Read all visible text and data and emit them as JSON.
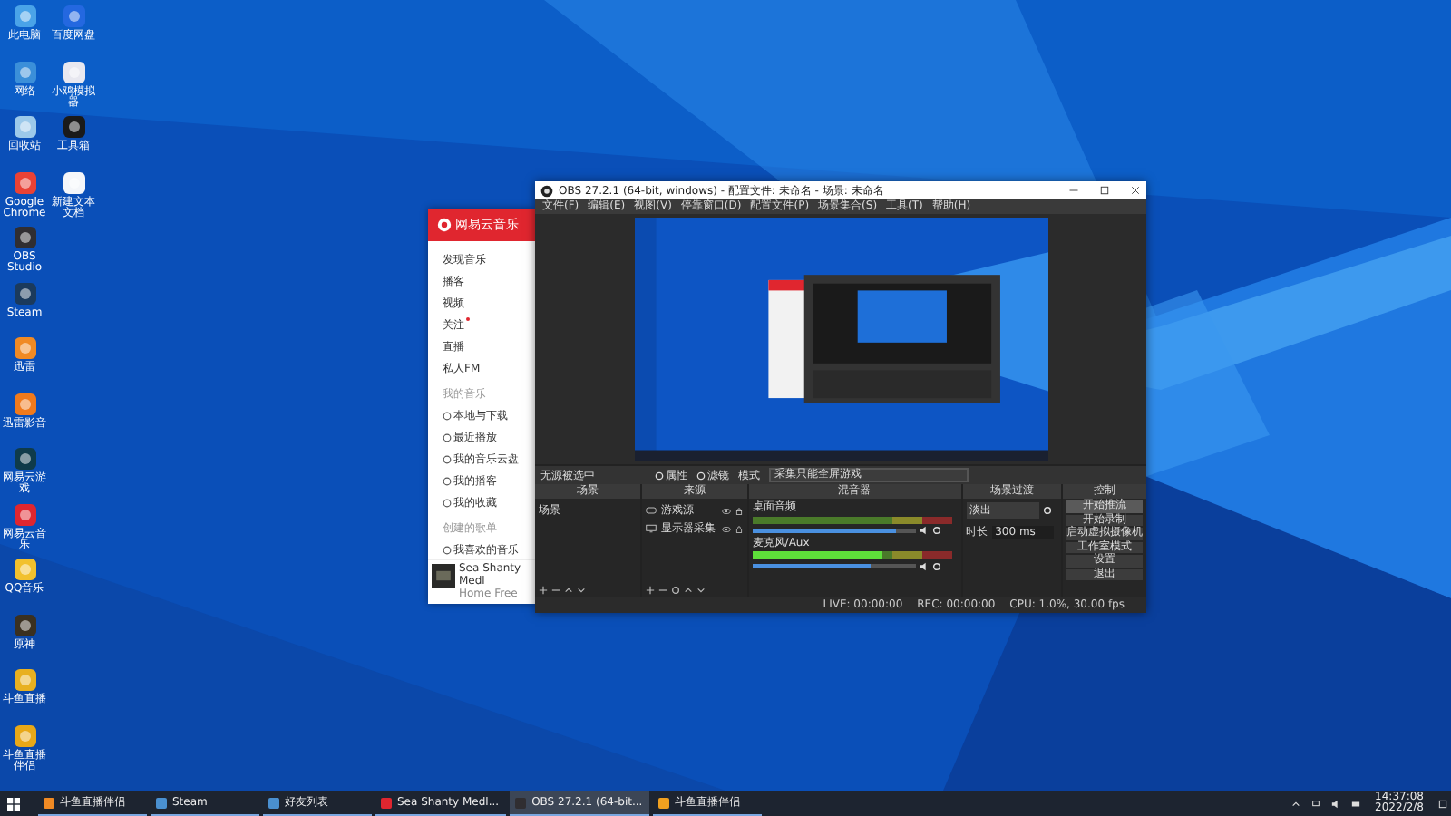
{
  "desktop_icons": {
    "column_1": [
      {
        "label": "此电脑",
        "color": "#4aa3e8"
      },
      {
        "label": "网络",
        "color": "#3b8fd9"
      },
      {
        "label": "回收站",
        "color": "#9cc9ea"
      },
      {
        "label": "Google Chrome",
        "color": "#e94235"
      },
      {
        "label": "OBS Studio",
        "color": "#302e31"
      },
      {
        "label": "Steam",
        "color": "#1b3a5c"
      },
      {
        "label": "迅雷",
        "color": "#f08a24"
      },
      {
        "label": "迅雷影音",
        "color": "#f07a1c"
      },
      {
        "label": "网易云游戏",
        "color": "#0f3b4a"
      },
      {
        "label": "网易云音乐",
        "color": "#e0262f"
      },
      {
        "label": "QQ音乐",
        "color": "#f2c12e"
      },
      {
        "label": "原神",
        "color": "#3a3020"
      },
      {
        "label": "斗鱼直播",
        "color": "#e8b020"
      },
      {
        "label": "斗鱼直播伴侣",
        "color": "#e8a818"
      }
    ],
    "column_2": [
      {
        "label": "百度网盘",
        "color": "#2468e0"
      },
      {
        "label": "小鸡模拟器",
        "color": "#e8e8f0"
      },
      {
        "label": "工具箱",
        "color": "#1a1a1a"
      },
      {
        "label": "新建文本文档",
        "color": "#f4f6fa"
      }
    ]
  },
  "music_window": {
    "title": "网易云音乐",
    "items": [
      {
        "label": "发现音乐",
        "kind": "item",
        "dot": false
      },
      {
        "label": "播客",
        "kind": "item",
        "dot": false
      },
      {
        "label": "视频",
        "kind": "item",
        "dot": false
      },
      {
        "label": "关注",
        "kind": "item",
        "dot": true
      },
      {
        "label": "直播",
        "kind": "item",
        "dot": false
      },
      {
        "label": "私人FM",
        "kind": "item",
        "dot": false
      },
      {
        "label": "我的音乐",
        "kind": "heading"
      },
      {
        "label": "本地与下载",
        "kind": "icon",
        "dot": false
      },
      {
        "label": "最近播放",
        "kind": "icon",
        "dot": false
      },
      {
        "label": "我的音乐云盘",
        "kind": "icon",
        "dot": false
      },
      {
        "label": "我的播客",
        "kind": "icon",
        "dot": false
      },
      {
        "label": "我的收藏",
        "kind": "icon",
        "dot": false
      },
      {
        "label": "创建的歌单",
        "kind": "heading"
      },
      {
        "label": "我喜欢的音乐",
        "kind": "icon",
        "dot": false
      }
    ],
    "now_playing": {
      "title": "Sea Shanty Medl",
      "artist": "Home Free"
    }
  },
  "obs_window": {
    "title": "OBS 27.2.1 (64-bit, windows) - 配置文件: 未命名 - 场景: 未命名",
    "menu": [
      "文件(F)",
      "编辑(E)",
      "视图(V)",
      "停靠窗口(D)",
      "配置文件(P)",
      "场景集合(S)",
      "工具(T)",
      "帮助(H)"
    ],
    "toolbar": {
      "selection": "无源被选中",
      "buttons": [
        "属性",
        "滤镜"
      ],
      "mode_label": "模式",
      "mode_value": "采集只能全屏游戏"
    },
    "docks": {
      "scenes": {
        "title": "场景",
        "items": [
          {
            "label": "场景",
            "selected": false
          }
        ]
      },
      "sources": {
        "title": "来源",
        "items": [
          {
            "label": "游戏源",
            "kind": "game"
          },
          {
            "label": "显示器采集",
            "kind": "display"
          }
        ]
      },
      "mixer": {
        "title": "混音器",
        "channels": [
          {
            "name": "桌面音频",
            "level": 0.88
          },
          {
            "name": "麦克风/Aux",
            "level": 0.73
          }
        ]
      },
      "transitions": {
        "title": "场景过渡",
        "type": "淡出",
        "duration_label": "时长",
        "duration": "300 ms"
      },
      "controls": {
        "title": "控制",
        "buttons": [
          {
            "label": "开始推流",
            "hover": true
          },
          {
            "label": "开始录制",
            "hover": false
          },
          {
            "label": "启动虚拟摄像机",
            "hover": false
          },
          {
            "label": "工作室模式",
            "hover": false
          },
          {
            "label": "设置",
            "hover": false
          },
          {
            "label": "退出",
            "hover": false
          }
        ]
      }
    },
    "status_bar": [
      "LIVE: 00:00:00",
      "REC: 00:00:00",
      "CPU: 1.0%, 30.00 fps"
    ]
  },
  "taskbar": {
    "items": [
      {
        "label": "斗鱼直播伴侣",
        "color": "#f08a24",
        "selected": false
      },
      {
        "label": "Steam",
        "color": "#4a90d0",
        "selected": false
      },
      {
        "label": "好友列表",
        "color": "#4a90d0",
        "selected": false
      },
      {
        "label": "Sea Shanty Medl...",
        "color": "#e0262f",
        "selected": false
      },
      {
        "label": "OBS 27.2.1 (64-bit...",
        "color": "#302e31",
        "selected": true
      },
      {
        "label": "斗鱼直播伴侣",
        "color": "#f0a020",
        "selected": false
      }
    ],
    "time": "14:37:08",
    "date": "2022/2/8"
  }
}
